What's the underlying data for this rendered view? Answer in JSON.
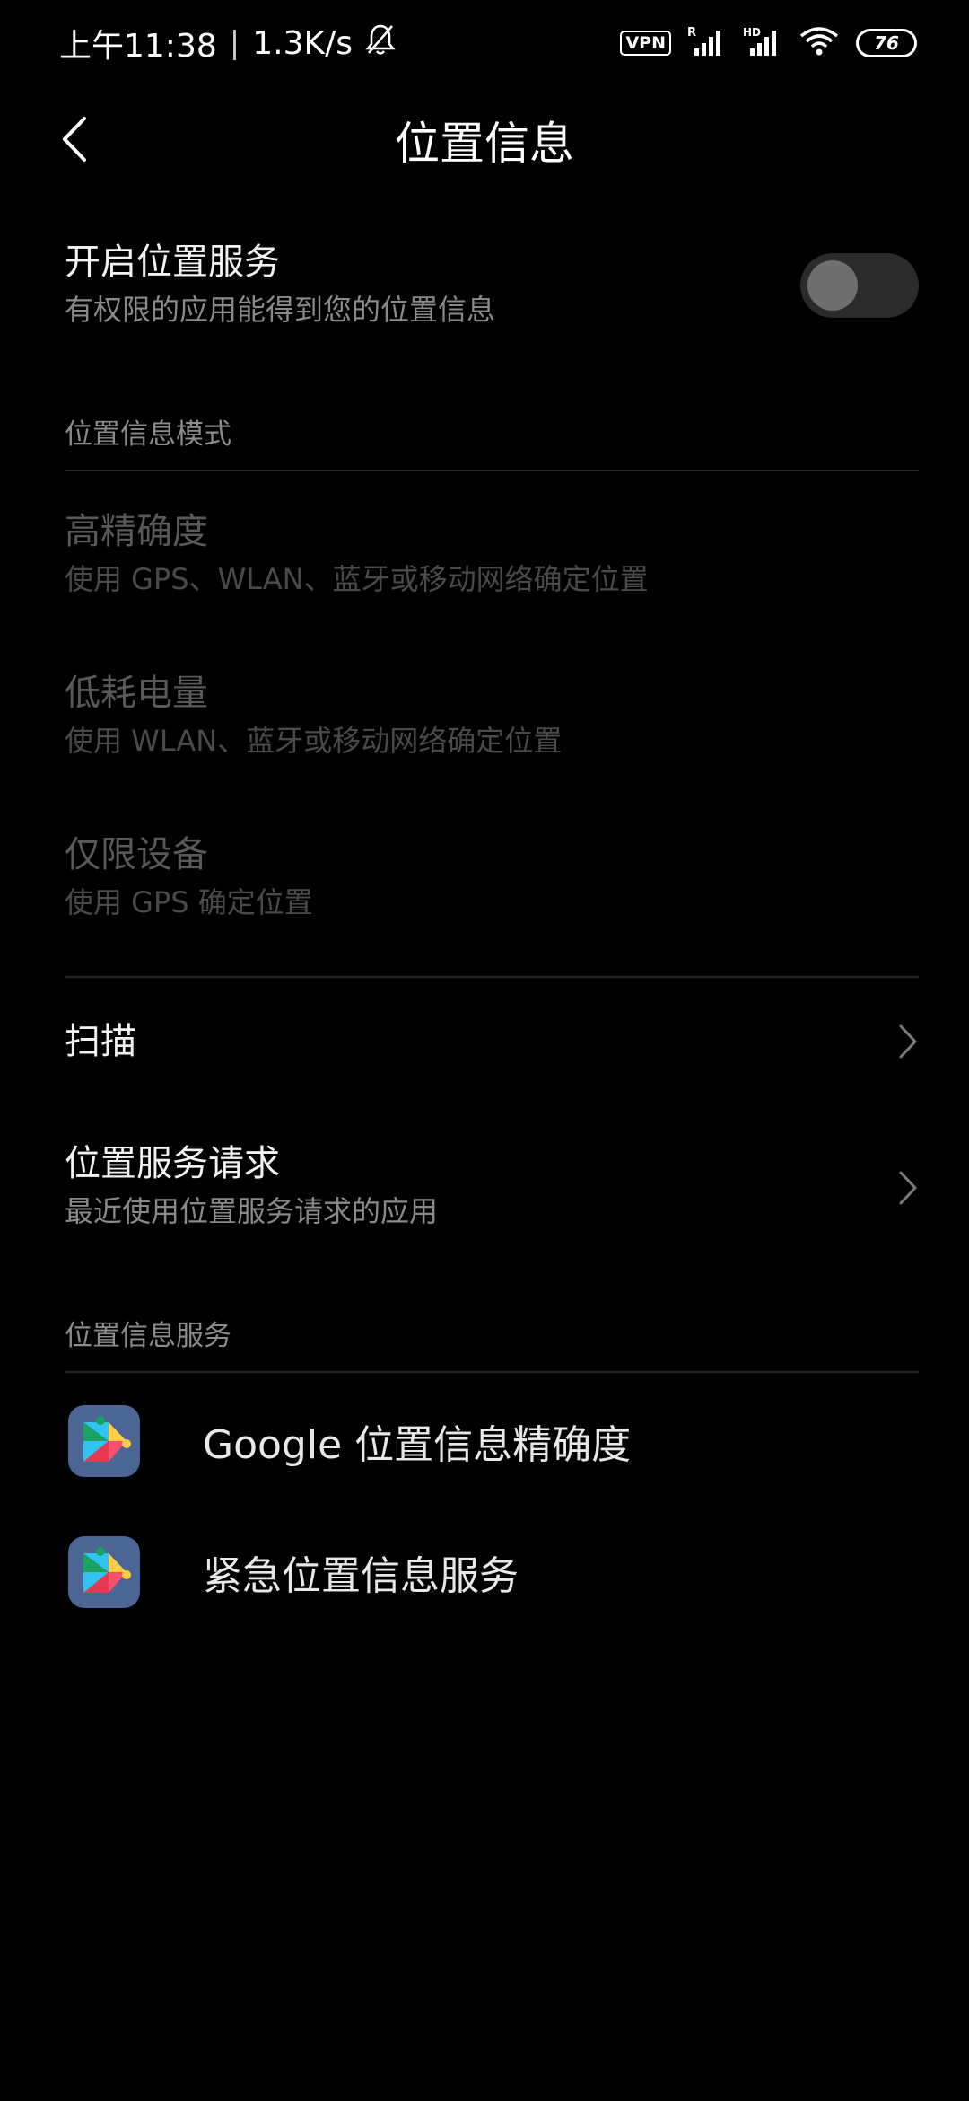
{
  "status_bar": {
    "time": "上午11:38",
    "separator": "|",
    "net_speed": "1.3K/s",
    "vpn": "VPN",
    "battery": "76",
    "icons": [
      "bell-off-icon",
      "signal-r-icon",
      "signal-hd-icon",
      "wifi-icon",
      "battery-icon"
    ]
  },
  "header": {
    "title": "位置信息",
    "back_icon": "chevron-left-icon"
  },
  "location_service": {
    "title": "开启位置服务",
    "subtitle": "有权限的应用能得到您的位置信息",
    "enabled": false
  },
  "mode_section": {
    "label": "位置信息模式",
    "items": [
      {
        "title": "高精确度",
        "subtitle": "使用 GPS、WLAN、蓝牙或移动网络确定位置"
      },
      {
        "title": "低耗电量",
        "subtitle": "使用 WLAN、蓝牙或移动网络确定位置"
      },
      {
        "title": "仅限设备",
        "subtitle": "使用 GPS 确定位置"
      }
    ]
  },
  "scan": {
    "title": "扫描"
  },
  "requests": {
    "title": "位置服务请求",
    "subtitle": "最近使用位置服务请求的应用"
  },
  "services_section": {
    "label": "位置信息服务",
    "items": [
      {
        "label": "Google 位置信息精确度",
        "icon": "google-play-services-icon"
      },
      {
        "label": "紧急位置信息服务",
        "icon": "google-play-services-icon"
      }
    ]
  },
  "colors": {
    "background": "#000000",
    "text_primary": "#f2f2f2",
    "text_secondary": "#8a8a8a",
    "text_disabled": "#595959",
    "toggle_track": "#2b2b2b",
    "app_icon_bg": "#4b6594"
  }
}
